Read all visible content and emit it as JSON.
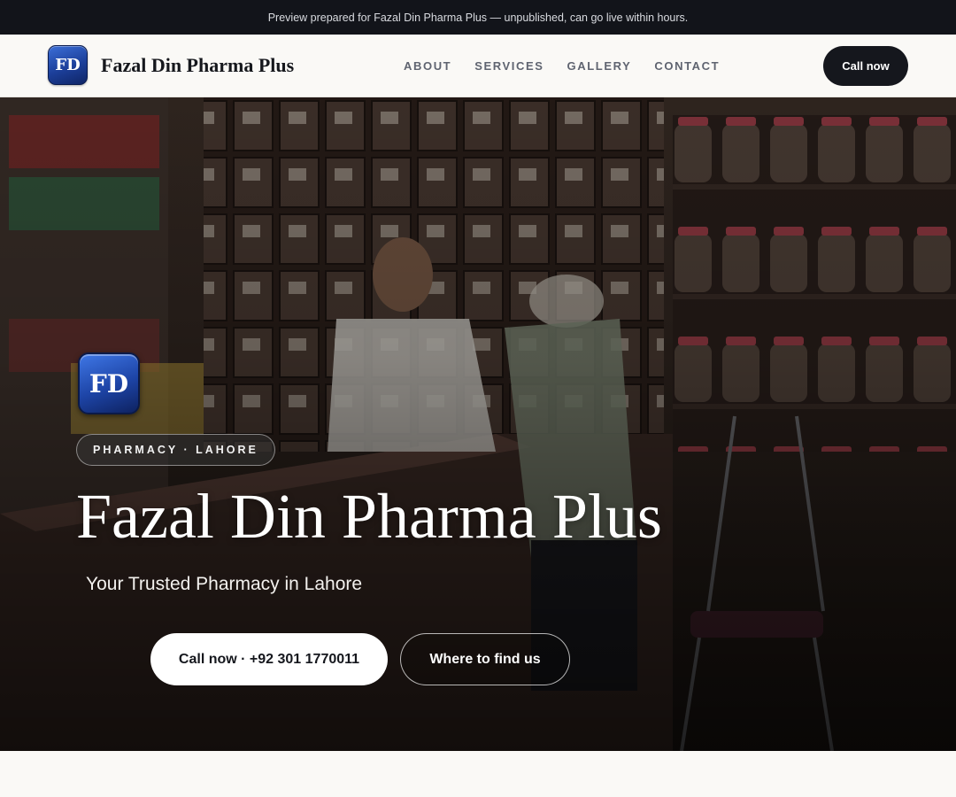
{
  "preview_banner": "Preview prepared for Fazal Din Pharma Plus — unpublished, can go live within hours.",
  "header": {
    "logo_text": "FD",
    "brand_name": "Fazal Din Pharma Plus",
    "nav": [
      "ABOUT",
      "SERVICES",
      "GALLERY",
      "CONTACT"
    ],
    "cta_label": "Call now"
  },
  "hero": {
    "logo_text": "FD",
    "eyebrow": "PHARMACY · LAHORE",
    "title": "Fazal Din Pharma Plus",
    "subtitle": "Your Trusted Pharmacy in Lahore",
    "primary_button": "Call now · +92 301 1770011",
    "secondary_button": "Where to find us",
    "background_image": "pharmacy-counter-photo"
  },
  "colors": {
    "dark": "#12141a",
    "logo_blue": "#1d44a6",
    "page_bg": "#faf9f6"
  }
}
